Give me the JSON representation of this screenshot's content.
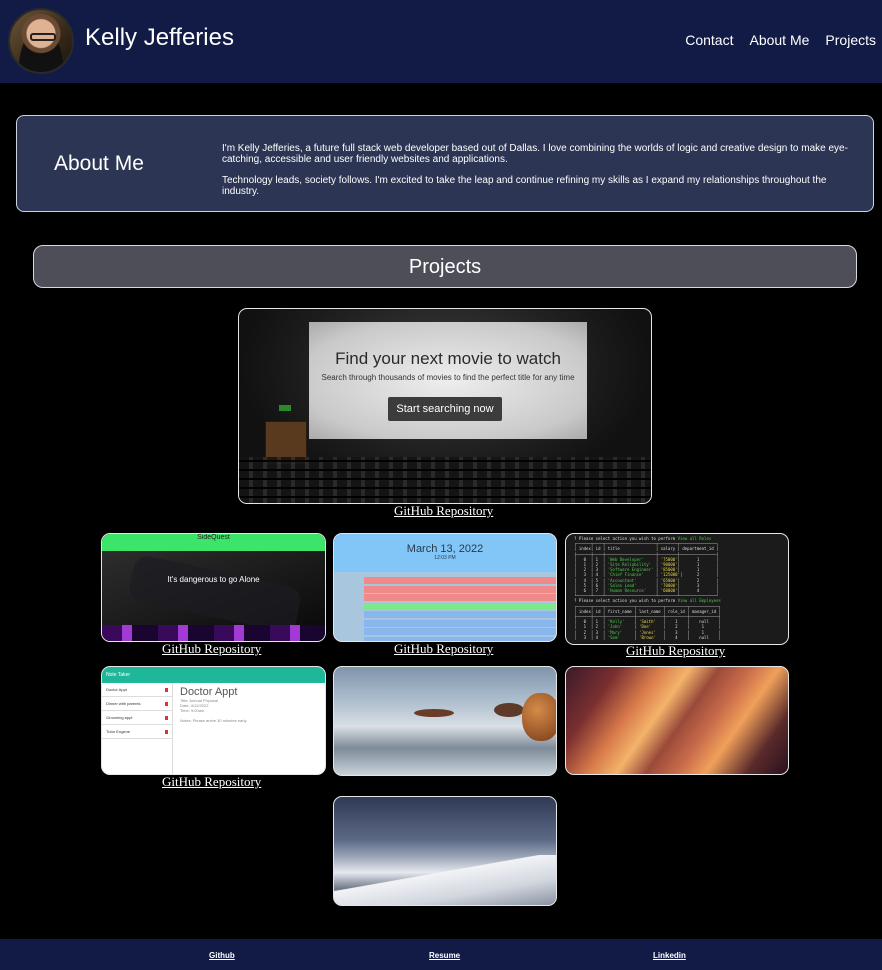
{
  "header": {
    "name": "Kelly Jefferies",
    "nav": [
      "Contact",
      "About Me",
      "Projects"
    ]
  },
  "about": {
    "title": "About Me",
    "paragraphs": [
      "I'm Kelly Jefferies, a future full stack web developer based out of Dallas. I love combining the worlds of logic and creative design to make eye-catching, accessible and user friendly websites and applications.",
      "Technology leads, society follows. I'm excited to take the leap and continue refining my skills as I expand my relationships throughout the industry."
    ]
  },
  "projects": {
    "title": "Projects",
    "repo_label": "GitHub Repository",
    "featured": {
      "headline": "Find your next movie to watch",
      "subtext": "Search through thousands of movies to find the perfect title for any time",
      "button": "Start searching now"
    },
    "planner": {
      "date": "March 13, 2022",
      "time": "12:03 PM"
    },
    "sidequest": {
      "brand": "SideQuest",
      "tagline": "It's dangerous to go Alone"
    },
    "notes": {
      "app_title": "Note Taker",
      "items": [
        "Doctor Appt",
        "Dinner with parents",
        "Grooming appt",
        "Tutor Eugene"
      ],
      "heading": "Doctor Appt",
      "details": [
        "Title: Annual Physical",
        "Date: 4/12/2022",
        "Time: 9:00am",
        "Notes: Please arrive 30 minutes early."
      ]
    }
  },
  "footer": {
    "links": [
      "Github",
      "Resume",
      "Linkedin"
    ]
  },
  "colors": {
    "header_bg": "#121b45",
    "about_bg": "#2d3554",
    "projects_bar_bg": "#4e4e59",
    "page_bg": "#000000"
  }
}
